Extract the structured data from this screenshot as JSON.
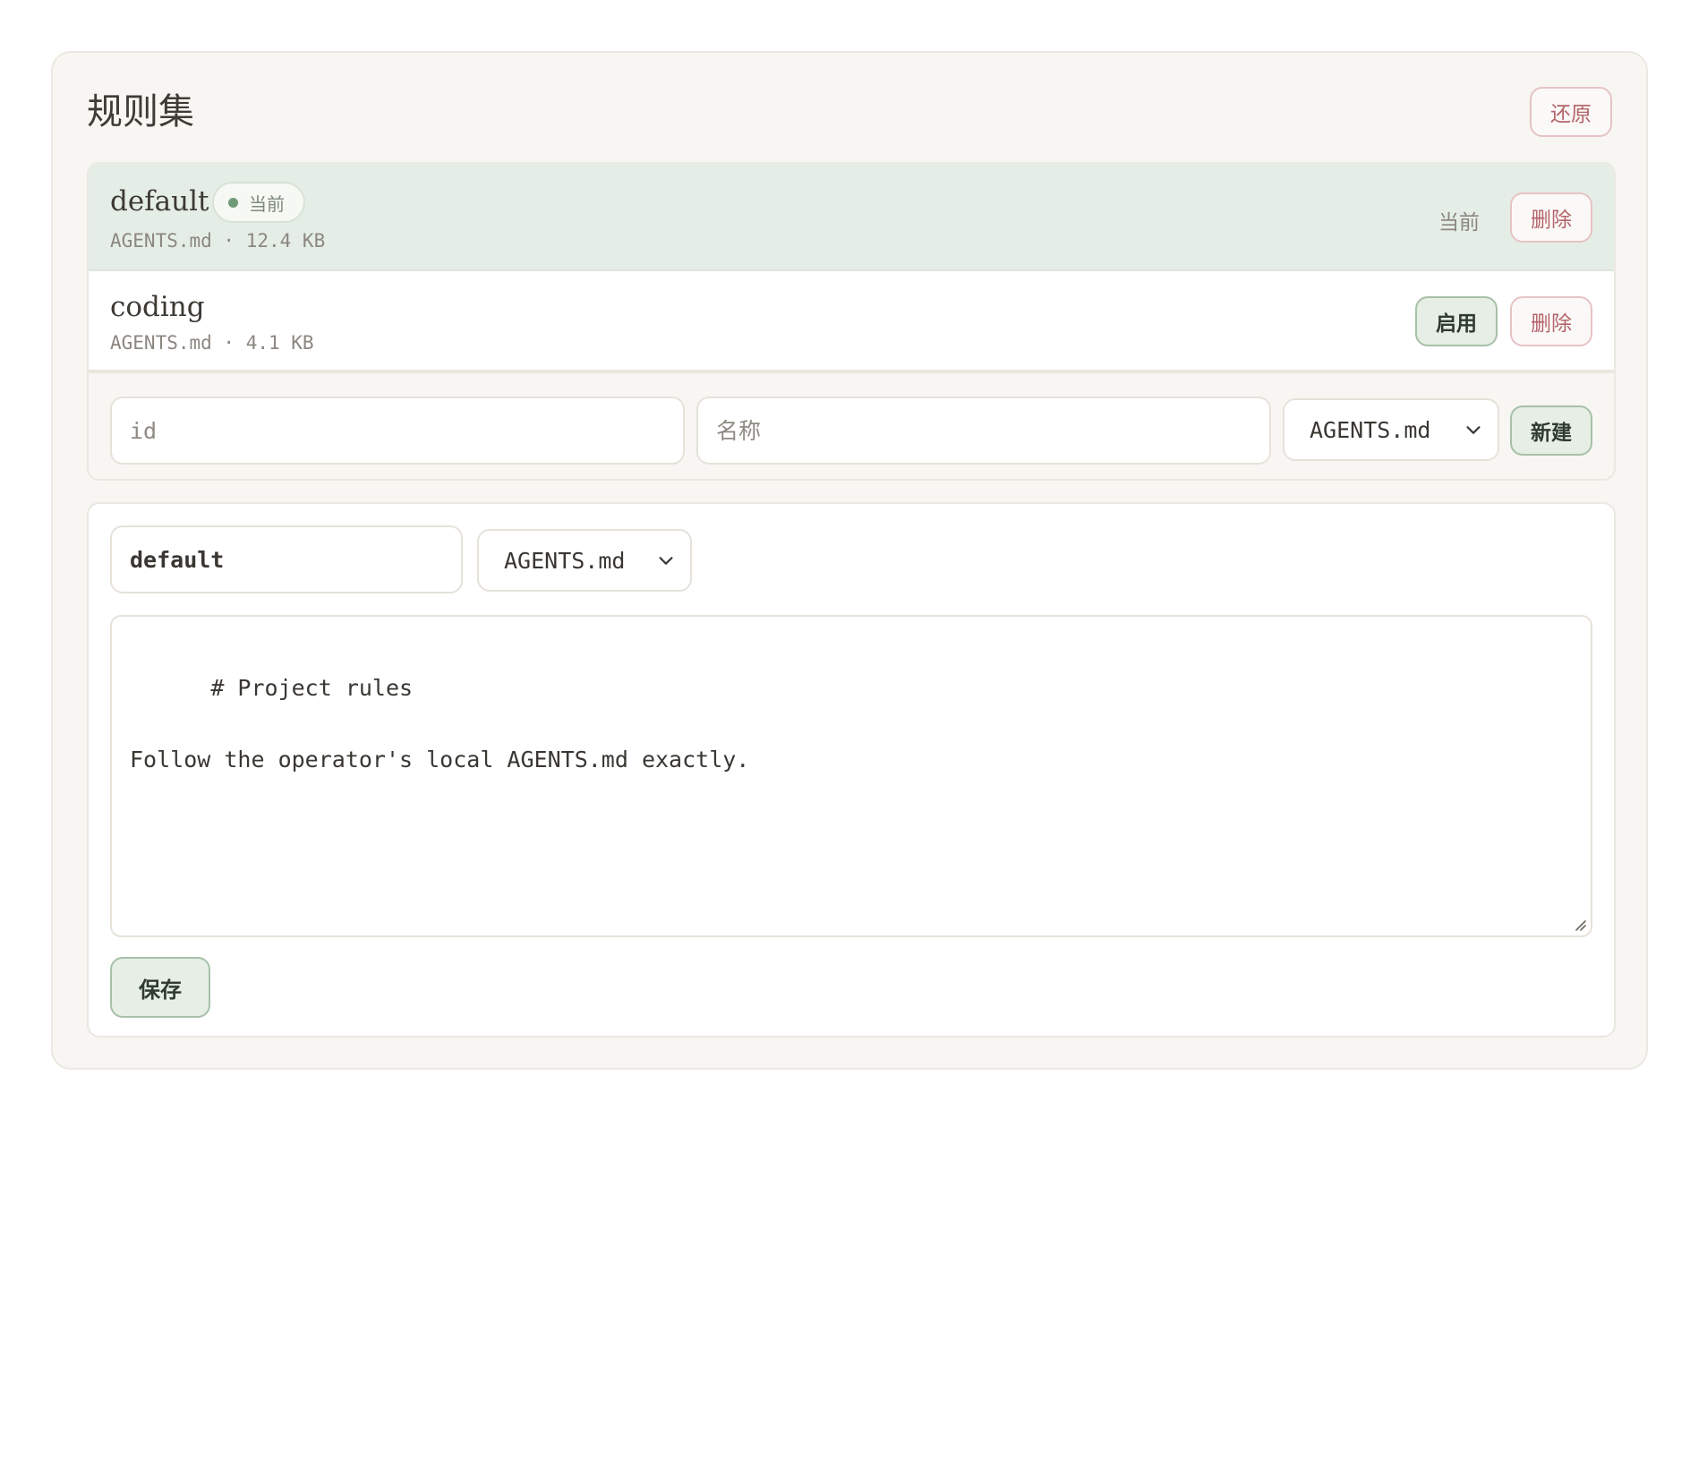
{
  "header": {
    "title": "规则集",
    "restore_label": "还原"
  },
  "rulesets": [
    {
      "name": "default",
      "meta": "AGENTS.md · 12.4 KB",
      "badge": "当前",
      "status_label": "当前",
      "delete_label": "删除"
    },
    {
      "name": "coding",
      "meta": "AGENTS.md · 4.1 KB",
      "enable_label": "启用",
      "delete_label": "删除"
    }
  ],
  "new_ruleset": {
    "id_placeholder": "id",
    "name_placeholder": "名称",
    "file_select": "AGENTS.md",
    "create_label": "新建"
  },
  "editor": {
    "id_value": "default",
    "file_select": "AGENTS.md",
    "content": "# Project rules\n\nFollow the operator's local AGENTS.md exactly.",
    "save_label": "保存"
  },
  "icons": {
    "select_chevron": "chevron-down-icon",
    "badge_dot": "status-dot-icon",
    "resize": "resize-handle-icon"
  },
  "colors": {
    "accent_green": "#6f9a78",
    "danger": "#b3646a",
    "active_row": "#e5eee6"
  }
}
